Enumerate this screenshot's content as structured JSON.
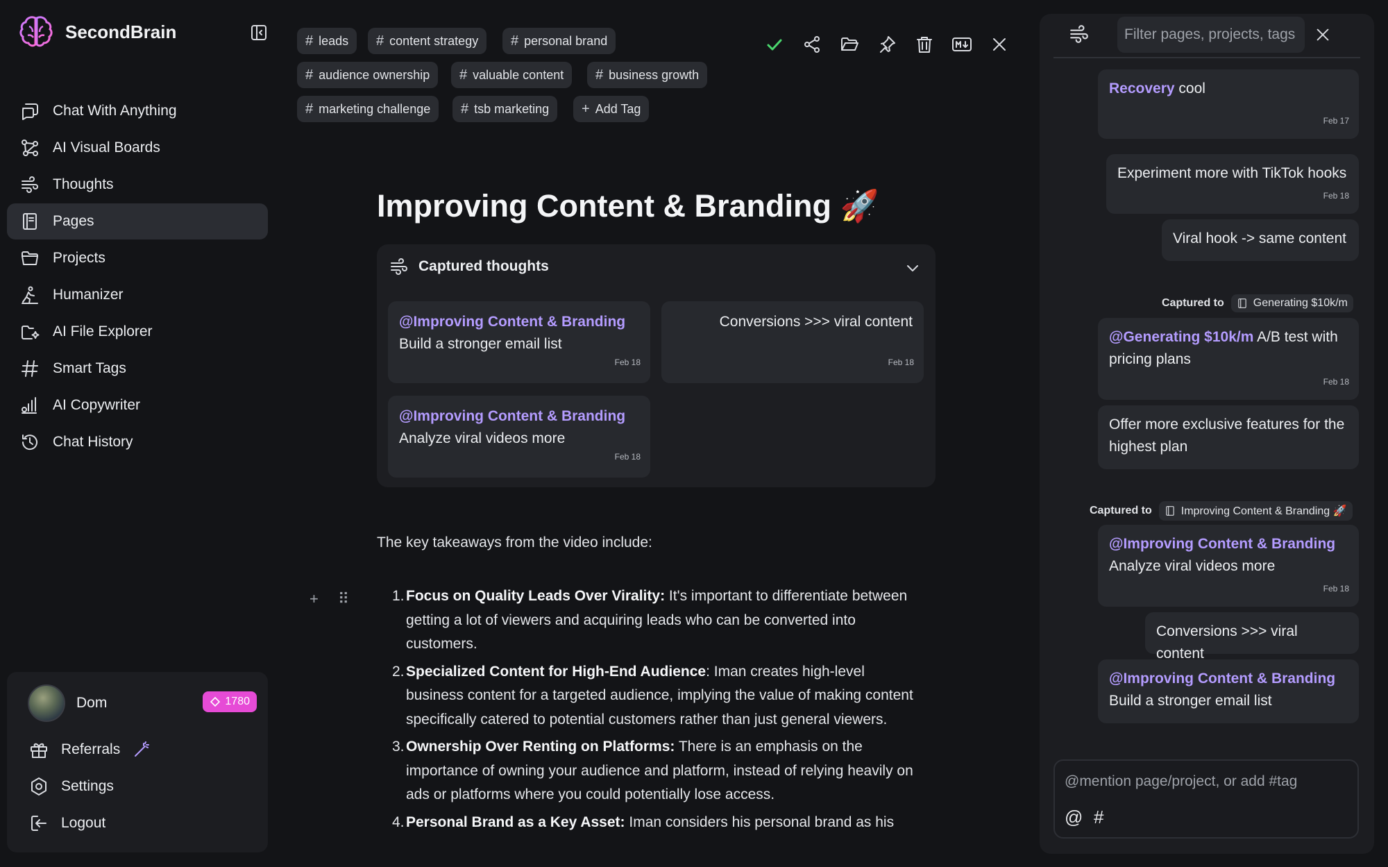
{
  "app": {
    "name": "SecondBrain"
  },
  "sidebar": {
    "items": [
      {
        "label": "Chat With Anything",
        "icon": "chat-icon"
      },
      {
        "label": "AI Visual Boards",
        "icon": "nodes-icon"
      },
      {
        "label": "Thoughts",
        "icon": "wind-icon"
      },
      {
        "label": "Pages",
        "icon": "page-icon",
        "active": true
      },
      {
        "label": "Projects",
        "icon": "folder-icon"
      },
      {
        "label": "Humanizer",
        "icon": "person-icon"
      },
      {
        "label": "AI File Explorer",
        "icon": "file-explorer-icon"
      },
      {
        "label": "Smart Tags",
        "icon": "hash-icon"
      },
      {
        "label": "AI Copywriter",
        "icon": "copywriter-icon"
      },
      {
        "label": "Chat History",
        "icon": "history-icon"
      }
    ],
    "account": {
      "user": "Dom",
      "credits": "1780",
      "referrals": "Referrals",
      "settings": "Settings",
      "logout": "Logout"
    }
  },
  "tags": [
    "leads",
    "content strategy",
    "personal brand",
    "audience ownership",
    "valuable content",
    "business growth",
    "marketing challenge",
    "tsb marketing"
  ],
  "add_tag": "Add Tag",
  "page": {
    "title": "Improving Content & Branding 🚀",
    "captured": {
      "heading": "Captured thoughts",
      "cards": [
        {
          "mention": "@Improving Content & Branding",
          "text": "Build a stronger email list",
          "date": "Feb 18"
        },
        {
          "mention": "",
          "text": "Conversions >>> viral content",
          "date": "Feb 18"
        },
        {
          "mention": "@Improving Content & Branding",
          "text": "Analyze viral videos more",
          "date": "Feb 18"
        }
      ]
    },
    "intro": "The key takeaways from the video include:",
    "list": [
      {
        "n": "1.",
        "bold": "Focus on Quality Leads Over Virality:",
        "text": " It's important to differentiate between getting a lot of viewers and acquiring leads who can be converted into customers."
      },
      {
        "n": "2.",
        "bold": "Specialized Content for High-End Audience",
        "text": ": Iman creates high-level business content for a targeted audience, implying the value of making content specifically catered to potential customers rather than just general viewers."
      },
      {
        "n": "3.",
        "bold": "Ownership Over Renting on Platforms:",
        "text": " There is an emphasis on the importance of owning your audience and platform, instead of relying heavily on ads or platforms where you could potentially lose access."
      },
      {
        "n": "4.",
        "bold": "Personal Brand as a Key Asset:",
        "text": " Iman considers his personal brand as his"
      }
    ]
  },
  "right_panel": {
    "search_placeholder": "Filter pages, projects, tags",
    "messages": [
      {
        "mention": "Recovery",
        "text": " cool",
        "date": "Feb 17"
      },
      {
        "mention": "",
        "text": "Experiment more with TikTok hooks",
        "date": "Feb 18"
      },
      {
        "mention": "",
        "text": "Viral hook -> same content",
        "date": ""
      },
      {
        "mention": "@Generating $10k/m",
        "text": " A/B test with pricing plans",
        "date": "Feb 18"
      },
      {
        "mention": "",
        "text": "Offer more exclusive features for the highest plan",
        "date": ""
      },
      {
        "mention": "@Improving Content & Branding",
        "text": " Analyze viral videos more",
        "date": "Feb 18"
      },
      {
        "mention": "",
        "text": "Conversions >>> viral content",
        "date": ""
      },
      {
        "mention": "@Improving Content & Branding",
        "text": " Build a stronger email list",
        "date": ""
      }
    ],
    "captured_to": [
      {
        "label": "Captured to",
        "target": "Generating $10k/m"
      },
      {
        "label": "Captured to",
        "target": "Improving Content & Branding 🚀"
      }
    ],
    "composer_placeholder": "@mention page/project, or add #tag",
    "composer_at": "@",
    "composer_hash": "#"
  },
  "colors": {
    "accent": "#b49cff",
    "credits_badge": "#e64bd6",
    "check": "#4ad66d"
  }
}
